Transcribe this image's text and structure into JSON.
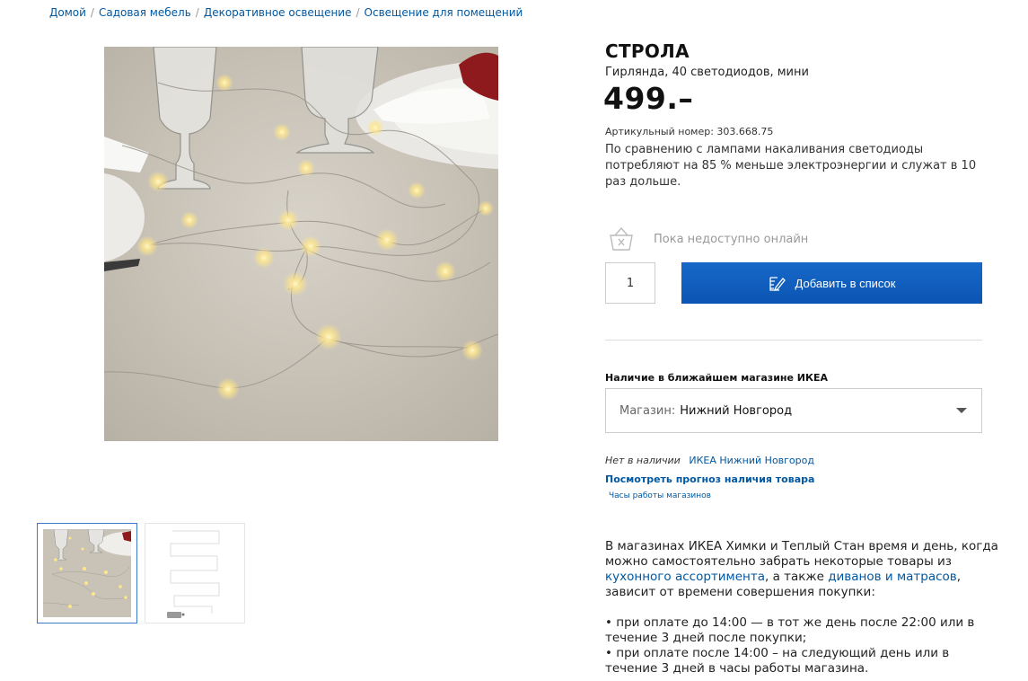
{
  "breadcrumbs": [
    "Домой",
    "Садовая мебель",
    "Декоративное освещение",
    "Освещение для помещений"
  ],
  "product": {
    "name": "СТРОЛА",
    "subtitle": "Гирлянда, 40 светодиодов, мини",
    "price": "499.–",
    "article": "Артикульный номер: 303.668.75",
    "description": "По сравнению с лампами накаливания светодиоды потребляют на 85 % меньше электроэнергии и служат в 10 раз дольше."
  },
  "online": {
    "status": "Пока недоступно онлайн",
    "icon": "basket-unavailable-icon"
  },
  "purchase": {
    "quantity": "1",
    "add_label": "Добавить в список",
    "add_icon": "pencil-list-icon"
  },
  "store": {
    "heading": "Наличие в ближайшем магазине ИКЕА",
    "select_label": "Магазин:",
    "select_value": "Нижний Новгород",
    "stock_status": "Нет в наличии",
    "stock_store": "ИКЕА Нижний Новгород",
    "forecast_link": "Посмотреть прогноз наличия товара",
    "hours_link": "Часы работы магазинов"
  },
  "info": {
    "p1_a": "В магазинах ИКЕА Химки и Теплый Стан время и день, когда можно самостоятельно забрать некоторые товары из ",
    "p1_link1": "кухонного ассортимента",
    "p1_b": ", а также ",
    "p1_link2": "диванов и матрасов",
    "p1_c": ", зависит от времени совершения покупки:",
    "bullet1": "• при оплате до 14:00 — в тот же день после 22:00 или в течение 3 дней после покупки;",
    "bullet2": "• при оплате после 14:00 – на следующий день или в течение 3 дней в часы работы магазина."
  },
  "colors": {
    "accent": "#0058a3",
    "button": "#0b55b3"
  }
}
